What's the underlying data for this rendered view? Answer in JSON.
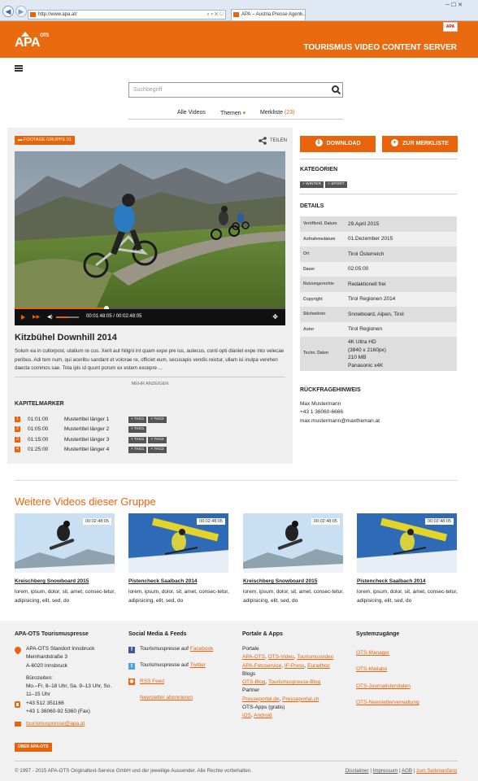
{
  "browser": {
    "url": "http://www.apa.at/",
    "tab_title": "APA – Austria Presse Agent...",
    "window_controls": "─  ☐  ✕"
  },
  "header": {
    "logo_text": "APA",
    "logo_sup": "OTS",
    "server_title": "TOURISMUS VIDEO CONTENT SERVER",
    "apa_badge": "APA"
  },
  "search": {
    "placeholder": "Suchbegriff"
  },
  "nav": {
    "items": [
      {
        "label": "Alle Videos"
      },
      {
        "label": "Themen",
        "caret": "▾"
      },
      {
        "label": "Merkliste",
        "count": "(23)"
      }
    ]
  },
  "video": {
    "group_tag": "FOOTAGE GRUPPE 01",
    "share_label": "TEILEN",
    "time": "00:01:48:05 / 00:02:48:05",
    "progress_fraction": 0.34,
    "volume_fraction": 0.55,
    "title": "Kitzbühel Downhill 2014",
    "description": "Solum ea in cullorpost, utatium re cus. Xerit aut hiligni int quam expe pre ius, autecus, conti opti dianiet expe into velecae peribus. Adi tem num, qui aceribu sandant et volorae re, officiet eum, secusapis vendis reictur, ullam isi inulpa verehen daecta commos sae. Tota ipis id quunt porum ex estem excepre ...",
    "more_label": "MEHR ANZEIGEN"
  },
  "kapitel": {
    "heading": "KAPITELMARKER",
    "rows": [
      {
        "num": "1",
        "time": "01:01:00",
        "title": "Mustertitel länger 1",
        "tags": [
          "TAG1",
          "TAG2"
        ]
      },
      {
        "num": "2",
        "time": "01:05:00",
        "title": "Mustertitel länger 2",
        "tags": [
          "TAG1"
        ]
      },
      {
        "num": "3",
        "time": "01:15:00",
        "title": "Mustertitel länger 3",
        "tags": [
          "TAG1",
          "TAG2"
        ]
      },
      {
        "num": "4",
        "time": "01:25:00",
        "title": "Mustertitel länger 4",
        "tags": [
          "TAG1",
          "TAG2"
        ]
      }
    ]
  },
  "actions": {
    "download": "DOWNLOAD",
    "merkliste": "ZUR MERKLISTE"
  },
  "kategorien": {
    "heading": "KATEGORIEN",
    "tags": [
      "WINTER",
      "SPORT"
    ]
  },
  "details": {
    "heading": "DETAILS",
    "rows": [
      {
        "key": "Veröffentl. Datum",
        "value": "29.April 2015"
      },
      {
        "key": "Aufnahmedatum",
        "value": "01.Dezember 2015"
      },
      {
        "key": "Ort",
        "value": "Tirol Österreich"
      },
      {
        "key": "Dauer",
        "value": "02:05:00"
      },
      {
        "key": "Nutzungsrechte",
        "value": "Redaktionell frei"
      },
      {
        "key": "Copyright",
        "value": "Tirol Regionen 2014"
      },
      {
        "key": "Stichwörter",
        "value": "Snowboard, Alpen, Tirol"
      },
      {
        "key": "Autor",
        "value": "Tirol Regionen"
      },
      {
        "key": "Techn. Daten",
        "lines": [
          "4K Ultra HD",
          "(3840 x 2160px)",
          "210 MB",
          "Panasonic x4K"
        ]
      }
    ]
  },
  "rueckfrage": {
    "heading": "RÜCKFRAGEHINWEIS",
    "name": "Max Mustermann",
    "phone": "+43 1 36060-6666",
    "email": "max.mustermann@maxtheman.at"
  },
  "group": {
    "heading": "Weitere Videos dieser Gruppe",
    "videos": [
      {
        "duration": "00:02:48:05",
        "title": "Kreischberg Snowboard 2015",
        "desc": "lorem, ipsum, dolor, sit, amet, consec-tetur, adipisicing, elit, sed, do"
      },
      {
        "duration": "00:02:48:05",
        "title": "Pistencheck Saalbach 2014",
        "desc": "lorem, ipsum, dolor, sit, amet, consec-tetur, adipisicing, elit, sed, do"
      },
      {
        "duration": "00:02:48:05",
        "title": "Kreischberg Snowboard 2015",
        "desc": "lorem, ipsum, dolor, sit, amet, consec-tetur, adipisicing, elit, sed, do"
      },
      {
        "duration": "00:02:48:05",
        "title": "Pistencheck Saalbach 2014",
        "desc": "lorem, ipsum, dolor, sit, amet, consec-tetur, adipisicing, elit, sed, do"
      }
    ]
  },
  "footer": {
    "col1": {
      "heading": "APA-OTS Tourismuspresse",
      "address": [
        "APA-OTS Standort Innsbruck",
        "Meinhardstraße 3",
        "A-6020 Innsbruck"
      ],
      "hours_label": "Bürozeiten:",
      "hours": [
        "Mo.–Fr. 8–18 Uhr, Sa. 9–13 Uhr, So.",
        "11–15 Uhr"
      ],
      "phones": [
        "+43 512 351166",
        "+43 1 36060-92 5360 (Fax)"
      ],
      "email": "tourismuspresse@apa.at",
      "button": "ÜBER APA-OTS"
    },
    "col2": {
      "heading": "Social Media & Feeds",
      "fb_prefix": "Tourismuspresse auf ",
      "fb_link": "Facebook",
      "tw_prefix": "Tourismuspresse auf ",
      "tw_link": "Twitter",
      "rss": "RSS Feed",
      "newsletter": "Newsletter abonnieren"
    },
    "col3": {
      "heading": "Portale & Apps",
      "portale_label": "Portale",
      "blogs_label": "Blogs",
      "partner_label": "Partner",
      "apps_label": "OTS-Apps (gratis)",
      "links": {
        "ots": "APA-OTS",
        "otsvideo": "OTS-Video",
        "tourismusvideo": "Tourismusvideo",
        "fotoservice": "APA-Fotoservice",
        "ifpress": "IF-Press",
        "euradhoc": "Euradhoc",
        "otsblog": "OTS-Blog",
        "tourismusblog": "Tourismuspresse-Blog",
        "presseportal_de": "Presseportal.de",
        "presseportal_ch": "Presseportal.ch",
        "ios": "iOS",
        "android": "Android"
      }
    },
    "col4": {
      "heading": "Systemzugänge",
      "links": [
        "OTS-Manager",
        "OTS-Mailabo",
        "OTS-Journalistendaten",
        "OTS-Newsletterverwaltung"
      ]
    },
    "copyright": "© 1997 - 2015 APA-OTS Originaltext-Service GmbH und der jeweilige Aussender. Alle Rechte vorbehalten.",
    "bottom_links": [
      "Disclaimer",
      "Impressum",
      "AGB",
      "zum Seitenanfang"
    ]
  },
  "colors": {
    "accent": "#ea6a0f",
    "card_bg": "#efefef",
    "chip_bg": "#555555"
  },
  "icons": [
    "back-icon",
    "forward-icon",
    "search-icon",
    "hamburger-icon",
    "share-icon",
    "folder-icon",
    "download-icon",
    "plus-icon",
    "play-icon",
    "volume-icon",
    "fullscreen-icon",
    "location-icon",
    "phone-icon",
    "mail-icon",
    "facebook-icon",
    "twitter-icon",
    "rss-icon"
  ]
}
